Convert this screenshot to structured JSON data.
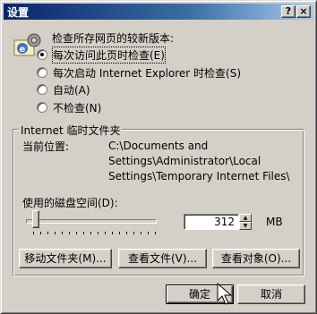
{
  "window": {
    "title": "设置",
    "help_btn": "?",
    "close_btn": "×"
  },
  "check": {
    "heading": "检查所存网页的较新版本:",
    "options": [
      {
        "label": "每次访问此页时检查(E)",
        "selected": true
      },
      {
        "label": "每次启动 Internet Explorer 时检查(S)",
        "selected": false
      },
      {
        "label": "自动(A)",
        "selected": false
      },
      {
        "label": "不检查(N)",
        "selected": false
      }
    ]
  },
  "temp": {
    "group_title": "Internet 临时文件夹",
    "location_label": "当前位置:",
    "location_lines": [
      "C:\\Documents and",
      "Settings\\Administrator\\Local",
      "Settings\\Temporary Internet Files\\"
    ],
    "disk_label": "使用的磁盘空间(D):",
    "disk_value": "312",
    "unit": "MB",
    "slider_fraction": 0.04
  },
  "buttons": {
    "move": "移动文件夹(M)...",
    "view_files": "查看文件(V)...",
    "view_objects": "查看对象(O)...",
    "ok": "确定",
    "cancel": "取消"
  },
  "colors": {
    "title_start": "#0a246a",
    "title_end": "#a6caf0",
    "face": "#d4d0c8"
  },
  "icons": {
    "app": "ie-gear-icon",
    "pointer": "mouse-cursor-icon"
  }
}
